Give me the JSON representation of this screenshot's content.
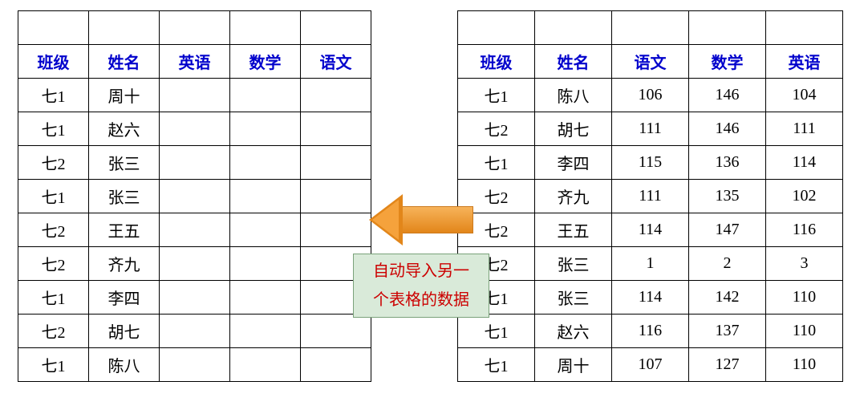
{
  "left_table": {
    "headers": [
      "班级",
      "姓名",
      "英语",
      "数学",
      "语文"
    ],
    "rows": [
      [
        "七1",
        "周十",
        "",
        "",
        ""
      ],
      [
        "七1",
        "赵六",
        "",
        "",
        ""
      ],
      [
        "七2",
        "张三",
        "",
        "",
        ""
      ],
      [
        "七1",
        "张三",
        "",
        "",
        ""
      ],
      [
        "七2",
        "王五",
        "",
        "",
        ""
      ],
      [
        "七2",
        "齐九",
        "",
        "",
        ""
      ],
      [
        "七1",
        "李四",
        "",
        "",
        ""
      ],
      [
        "七2",
        "胡七",
        "",
        "",
        ""
      ],
      [
        "七1",
        "陈八",
        "",
        "",
        ""
      ]
    ]
  },
  "right_table": {
    "headers": [
      "班级",
      "姓名",
      "语文",
      "数学",
      "英语"
    ],
    "rows": [
      [
        "七1",
        "陈八",
        "106",
        "146",
        "104"
      ],
      [
        "七2",
        "胡七",
        "111",
        "146",
        "111"
      ],
      [
        "七1",
        "李四",
        "115",
        "136",
        "114"
      ],
      [
        "七2",
        "齐九",
        "111",
        "135",
        "102"
      ],
      [
        "七2",
        "王五",
        "114",
        "147",
        "116"
      ],
      [
        "七2",
        "张三",
        "1",
        "2",
        "3"
      ],
      [
        "七1",
        "张三",
        "114",
        "142",
        "110"
      ],
      [
        "七1",
        "赵六",
        "116",
        "137",
        "110"
      ],
      [
        "七1",
        "周十",
        "107",
        "127",
        "110"
      ]
    ]
  },
  "callout": {
    "line1": "自动导入另一",
    "line2": "个表格的数据"
  },
  "arrow": {
    "direction": "left",
    "color": "#f5a23c"
  }
}
